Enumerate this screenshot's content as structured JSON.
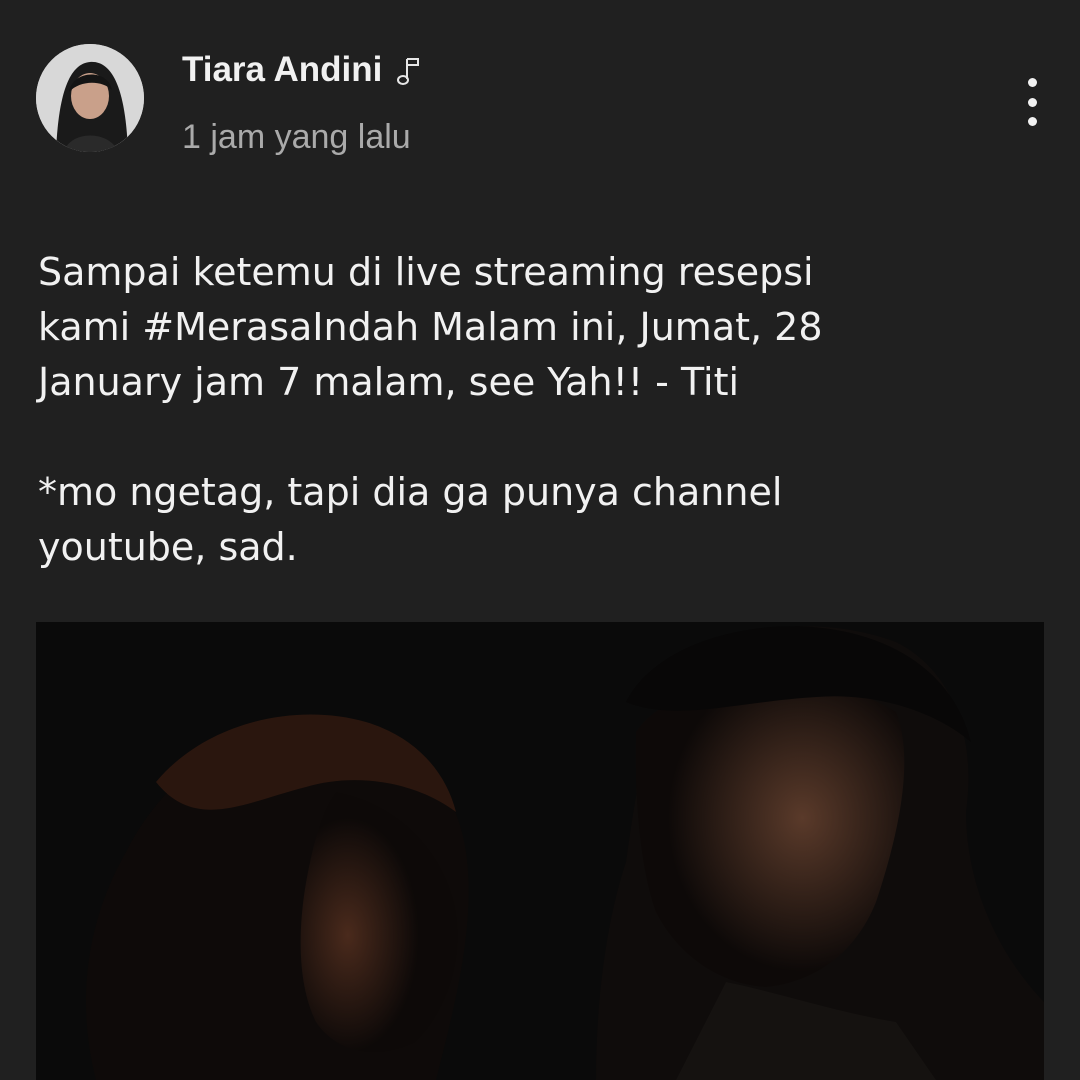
{
  "post": {
    "author": {
      "name": "Tiara Andini",
      "badge_icon": "music-note-icon",
      "avatar_icon": "profile-photo"
    },
    "timestamp": "1 jam yang lalu",
    "menu_icon": "more-vertical-icon",
    "text": {
      "paragraph1_lines": [
        "Sampai ketemu di live streaming resepsi",
        "kami #MerasaIndah Malam ini, Jumat, 28",
        "January jam 7 malam, see Yah!! - Titi"
      ],
      "paragraph2_lines": [
        "*mo ngetag, tapi dia ga punya channel",
        "youtube, sad."
      ]
    },
    "image": {
      "description_icon": "post-photo"
    }
  },
  "colors": {
    "background": "#202020",
    "text_primary": "#f1f1f1",
    "text_secondary": "#aaaaaa"
  }
}
